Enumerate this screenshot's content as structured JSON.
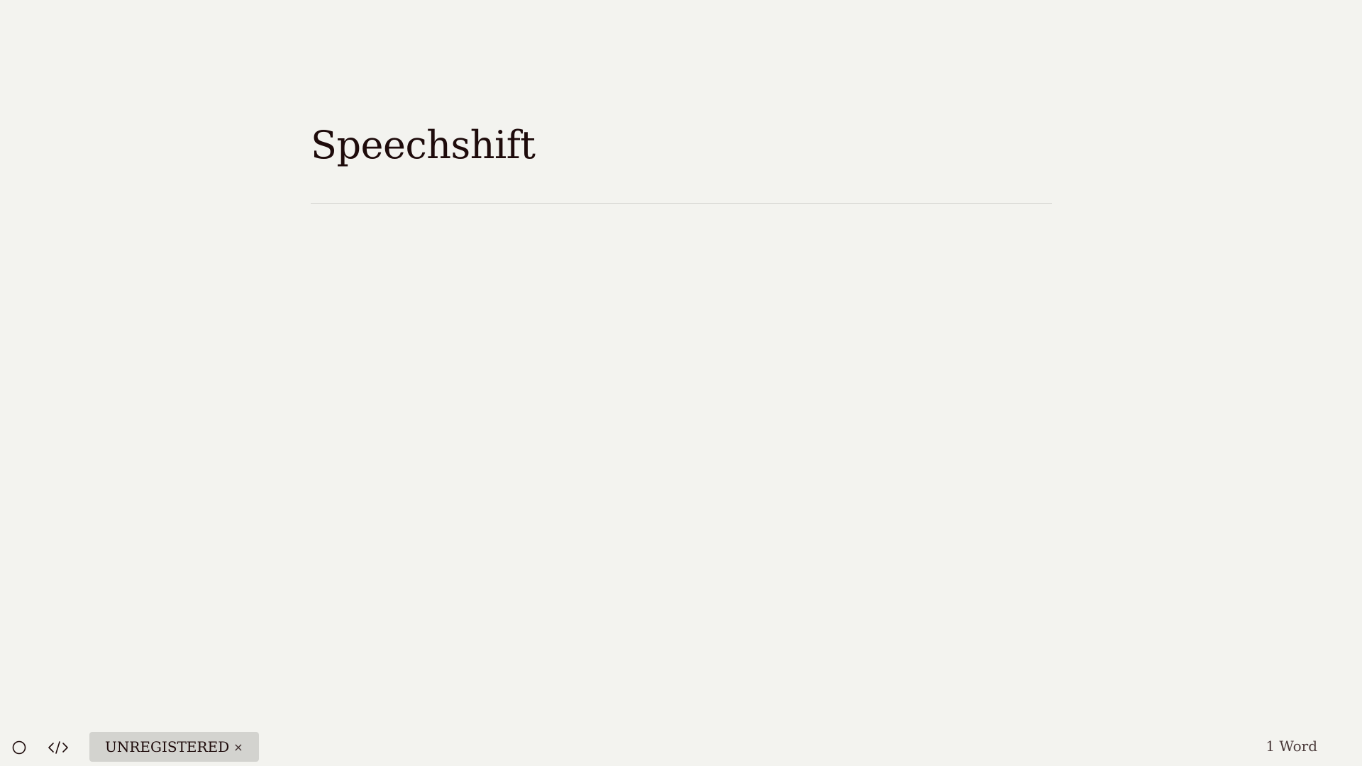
{
  "document": {
    "title": "Speechshift",
    "body": ""
  },
  "status_bar": {
    "left_icons": [
      "circle-icon",
      "code-icon"
    ],
    "badge_label": "UNREGISTERED",
    "badge_close": "×",
    "word_count": "1 Word"
  },
  "colors": {
    "background": "#f3f3ef",
    "text": "#1e0b0b",
    "rule": "#cfcfcb",
    "badge_background": "#d3d3cf"
  }
}
